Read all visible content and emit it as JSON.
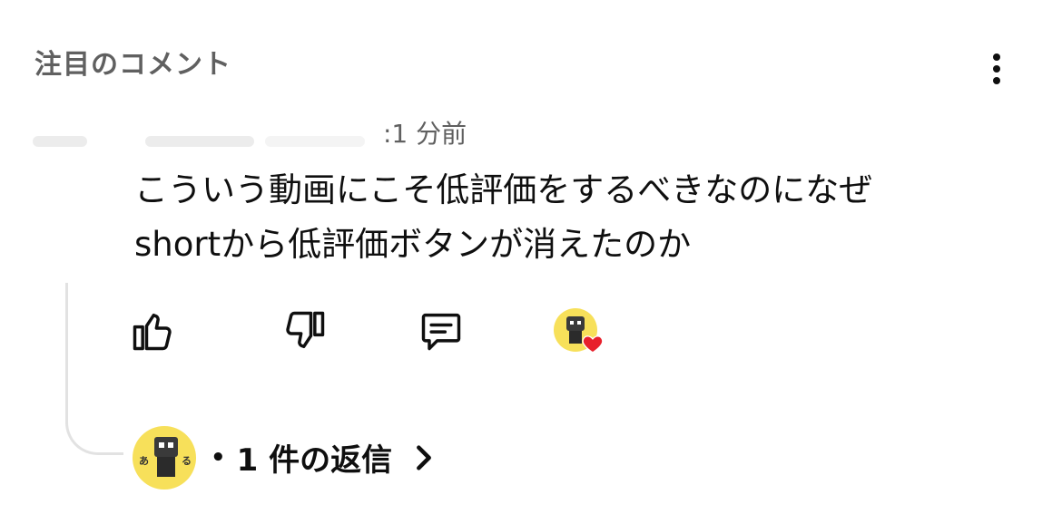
{
  "header": {
    "title": "注目のコメント"
  },
  "comment": {
    "timestamp": ":1 分前",
    "text": "こういう動画にこそ低評価をするべきなのになぜ\nshortから低評価ボタンが消えたのか"
  },
  "actions": {
    "like_icon": "thumb-up-icon",
    "dislike_icon": "thumb-down-icon",
    "reply_icon": "comment-reply-icon",
    "heart_color": "#e8202b"
  },
  "replies": {
    "separator": "•",
    "label": "1 件の返信"
  },
  "avatar_chars": {
    "left": "あ",
    "right": "る"
  },
  "colors": {
    "avatar_bg": "#f7e05a",
    "secondary_text": "#606060"
  }
}
